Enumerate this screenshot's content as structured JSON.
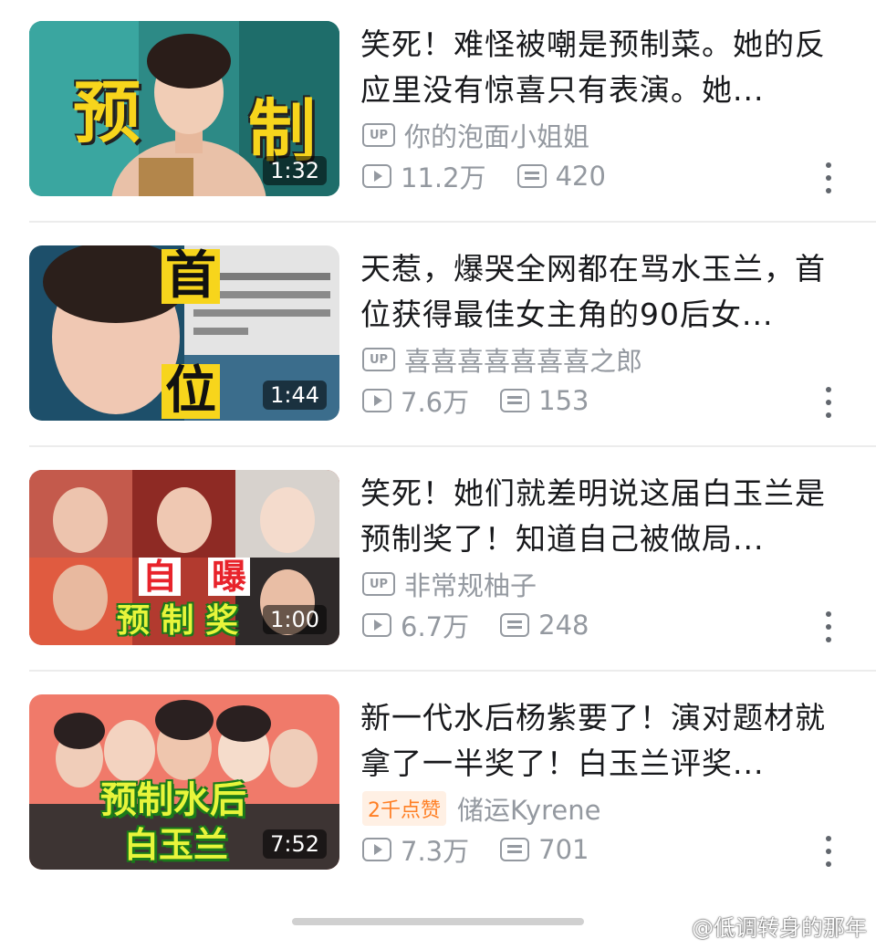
{
  "items": [
    {
      "title": "笑死！难怪被嘲是预制菜。她的反应里没有惊喜只有表演。她...",
      "author": "你的泡面小姐姐",
      "views": "11.2万",
      "danmaku": "420",
      "duration": "1:32",
      "overlay": [
        "预",
        "制"
      ],
      "badge": ""
    },
    {
      "title": "天惹，爆哭全网都在骂水玉兰，首位获得最佳女主角的90后女...",
      "author": "喜喜喜喜喜喜喜之郎",
      "views": "7.6万",
      "danmaku": "153",
      "duration": "1:44",
      "overlay": [
        "首",
        "位"
      ],
      "badge": ""
    },
    {
      "title": "笑死！她们就差明说这届白玉兰是预制奖了！知道自己被做局...",
      "author": "非常规柚子",
      "views": "6.7万",
      "danmaku": "248",
      "duration": "1:00",
      "overlay": [
        "自",
        "曝",
        "预 制 奖"
      ],
      "badge": ""
    },
    {
      "title": "新一代水后杨紫要了！演对题材就拿了一半奖了！白玉兰评奖...",
      "author": "储运Kyrene",
      "views": "7.3万",
      "danmaku": "701",
      "duration": "7:52",
      "overlay": [
        "预制水后",
        "白玉兰"
      ],
      "badge": "2千点赞"
    }
  ],
  "up_label": "UP",
  "watermark": "@低调转身的那年",
  "colors": {
    "accent_badge": "#ff7f24",
    "meta_grey": "#9499a0"
  }
}
